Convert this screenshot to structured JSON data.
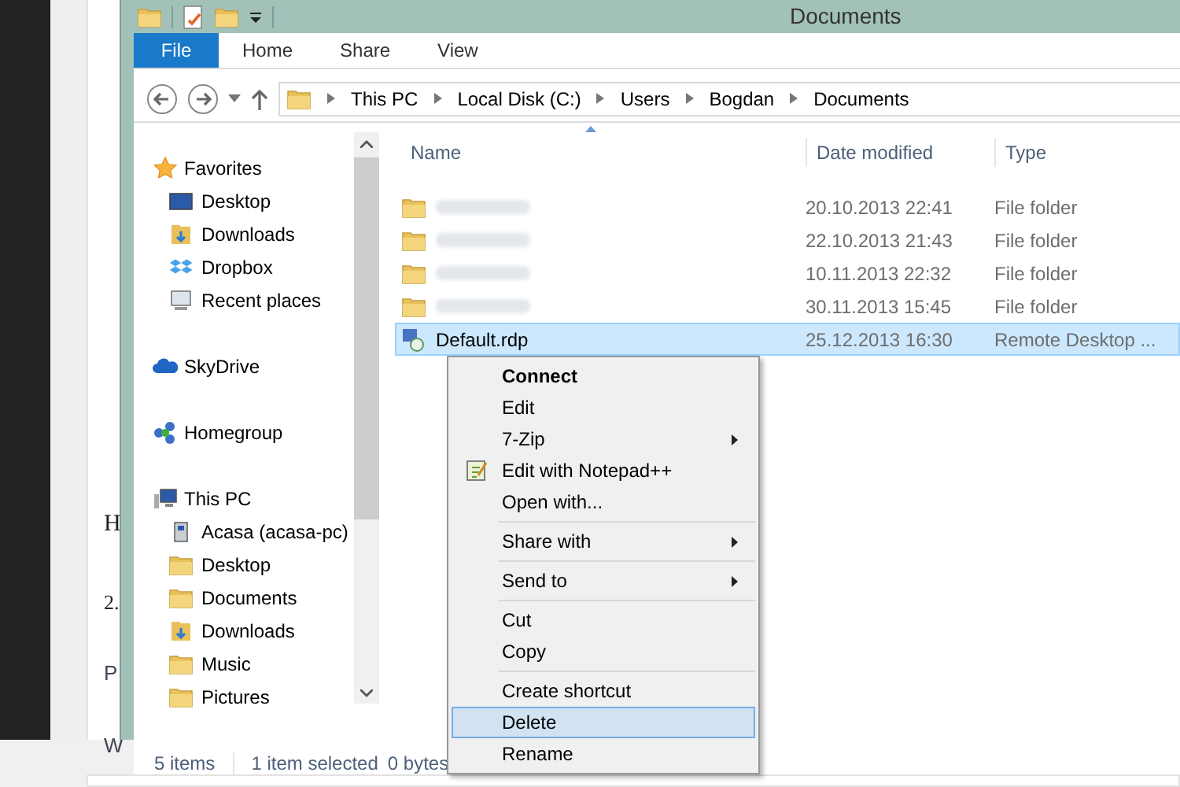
{
  "background_page": {
    "fragments": [
      {
        "text": "H",
        "kind": "heading"
      },
      {
        "text": "2.",
        "kind": "paragraph"
      },
      {
        "text": "P",
        "kind": "row"
      },
      {
        "text": "W",
        "kind": "row"
      }
    ]
  },
  "window": {
    "title": "Documents"
  },
  "ribbon_tabs": [
    {
      "label": "File",
      "selected": true
    },
    {
      "label": "Home",
      "selected": false
    },
    {
      "label": "Share",
      "selected": false
    },
    {
      "label": "View",
      "selected": false
    }
  ],
  "address_bar": {
    "path": [
      "This PC",
      "Local Disk (C:)",
      "Users",
      "Bogdan",
      "Documents"
    ]
  },
  "nav_pane": [
    {
      "label": "Favorites",
      "kind": "star",
      "children": [
        {
          "label": "Desktop",
          "kind": "monitor"
        },
        {
          "label": "Downloads",
          "kind": "download-folder"
        },
        {
          "label": "Dropbox",
          "kind": "dropbox"
        },
        {
          "label": "Recent places",
          "kind": "recent"
        }
      ]
    },
    {
      "label": "SkyDrive",
      "kind": "cloud"
    },
    {
      "label": "Homegroup",
      "kind": "network"
    },
    {
      "label": "This PC",
      "kind": "pc",
      "children": [
        {
          "label": "Acasa (acasa-pc)",
          "kind": "network-drive"
        },
        {
          "label": "Desktop",
          "kind": "folder"
        },
        {
          "label": "Documents",
          "kind": "folder"
        },
        {
          "label": "Downloads",
          "kind": "download-folder"
        },
        {
          "label": "Music",
          "kind": "folder"
        },
        {
          "label": "Pictures",
          "kind": "folder"
        }
      ]
    }
  ],
  "columns": [
    "Name",
    "Date modified",
    "Type"
  ],
  "files": [
    {
      "kind": "folder",
      "date": "20.10.2013 22:41",
      "type": "File folder",
      "selected": false
    },
    {
      "kind": "folder",
      "date": "22.10.2013 21:43",
      "type": "File folder",
      "selected": false
    },
    {
      "kind": "folder",
      "date": "10.11.2013 22:32",
      "type": "File folder",
      "selected": false
    },
    {
      "kind": "folder",
      "date": "30.11.2013 15:45",
      "type": "File folder",
      "selected": false
    },
    {
      "kind": "rdp",
      "name": "Default.rdp",
      "date": "25.12.2013 16:30",
      "type": "Remote Desktop ...",
      "selected": true
    }
  ],
  "status_bar": {
    "count": "5 items",
    "selection": "1 item selected",
    "size": "0 bytes"
  },
  "context_menu": [
    {
      "kind": "item",
      "label": "Connect",
      "default": true,
      "submenu": false,
      "selected": false
    },
    {
      "kind": "item",
      "label": "Edit",
      "default": false,
      "submenu": false,
      "selected": false
    },
    {
      "kind": "item",
      "label": "7-Zip",
      "default": false,
      "submenu": true,
      "selected": false
    },
    {
      "kind": "notepad",
      "label": "Edit with Notepad++",
      "default": false,
      "submenu": false,
      "selected": false
    },
    {
      "kind": "item",
      "label": "Open with...",
      "default": false,
      "submenu": false,
      "selected": false
    },
    {
      "kind": "separator"
    },
    {
      "kind": "item",
      "label": "Share with",
      "default": false,
      "submenu": true,
      "selected": false
    },
    {
      "kind": "separator"
    },
    {
      "kind": "item",
      "label": "Send to",
      "default": false,
      "submenu": true,
      "selected": false
    },
    {
      "kind": "separator"
    },
    {
      "kind": "item",
      "label": "Cut",
      "default": false,
      "submenu": false,
      "selected": false
    },
    {
      "kind": "item",
      "label": "Copy",
      "default": false,
      "submenu": false,
      "selected": false
    },
    {
      "kind": "separator"
    },
    {
      "kind": "item",
      "label": "Create shortcut",
      "default": false,
      "submenu": false,
      "selected": false
    },
    {
      "kind": "item",
      "label": "Delete",
      "default": false,
      "submenu": false,
      "selected": true
    },
    {
      "kind": "item",
      "label": "Rename",
      "default": false,
      "submenu": false,
      "selected": false
    }
  ]
}
